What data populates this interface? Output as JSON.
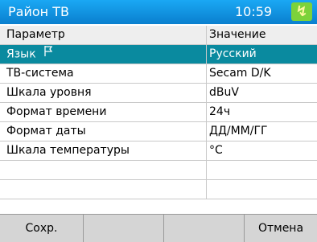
{
  "titlebar": {
    "title": "Район ТВ",
    "time": "10:59",
    "battery_icon": "battery-charging-icon"
  },
  "table": {
    "header": {
      "param": "Параметр",
      "value": "Значение"
    },
    "rows": [
      {
        "param": "Язык",
        "value": "Русский",
        "selected": true,
        "icon": "language-flag-icon"
      },
      {
        "param": "ТВ-система",
        "value": "Secam D/K"
      },
      {
        "param": "Шкала уровня",
        "value": "dBuV"
      },
      {
        "param": "Формат времени",
        "value": "24ч"
      },
      {
        "param": "Формат даты",
        "value": "ДД/ММ/ГГ"
      },
      {
        "param": "Шкала температуры",
        "value": "°C"
      },
      {
        "param": "",
        "value": ""
      },
      {
        "param": "",
        "value": ""
      }
    ]
  },
  "softkeys": {
    "left": "Сохр.",
    "mid1": "",
    "mid2": "",
    "right": "Отмена"
  },
  "colors": {
    "titlebar": "#0a8fdc",
    "selection": "#0a8a9f",
    "battery": "#7cd23a"
  }
}
